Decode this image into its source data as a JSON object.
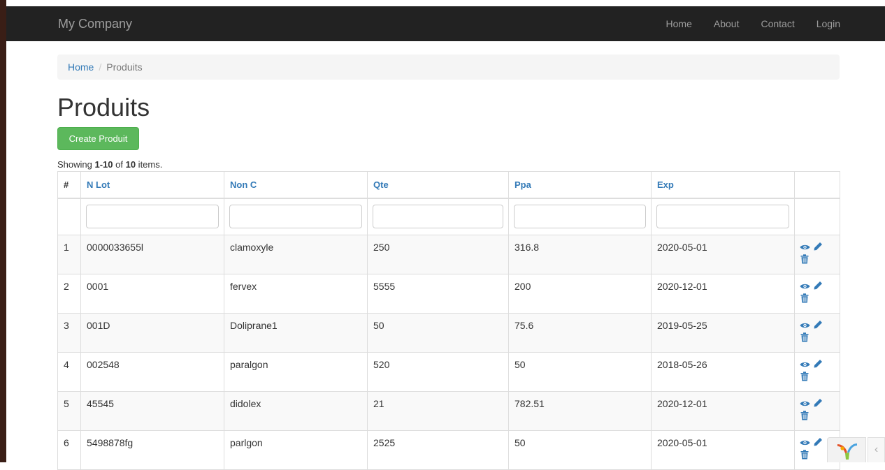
{
  "navbar": {
    "brand": "My Company",
    "links": [
      "Home",
      "About",
      "Contact",
      "Login"
    ]
  },
  "breadcrumb": {
    "home": "Home",
    "separator": "/",
    "current": "Produits"
  },
  "page": {
    "title": "Produits",
    "create_label": "Create Produit",
    "summary": {
      "prefix": "Showing ",
      "range": "1-10",
      "middle": " of ",
      "total": "10",
      "suffix": " items."
    }
  },
  "table": {
    "headers": [
      "#",
      "N Lot",
      "Non C",
      "Qte",
      "Ppa",
      "Exp"
    ],
    "rows": [
      [
        "1",
        "0000033655l",
        "clamoxyle",
        "250",
        "316.8",
        "2020-05-01"
      ],
      [
        "2",
        "0001",
        "fervex",
        "5555",
        "200",
        "2020-12-01"
      ],
      [
        "3",
        "001D",
        "Doliprane1",
        "50",
        "75.6",
        "2019-05-25"
      ],
      [
        "4",
        "002548",
        "paralgon",
        "520",
        "50",
        "2018-05-26"
      ],
      [
        "5",
        "45545",
        "didolex",
        "21",
        "782.51",
        "2020-12-01"
      ],
      [
        "6",
        "5498878fg",
        "parlgon",
        "2525",
        "50",
        "2020-05-01"
      ]
    ]
  },
  "debug_toolbar": {
    "toggle_label": "‹"
  },
  "colors": {
    "navbar_bg": "#222222",
    "link": "#337ab7",
    "success": "#5cb85c",
    "icon": "#337ab7"
  }
}
